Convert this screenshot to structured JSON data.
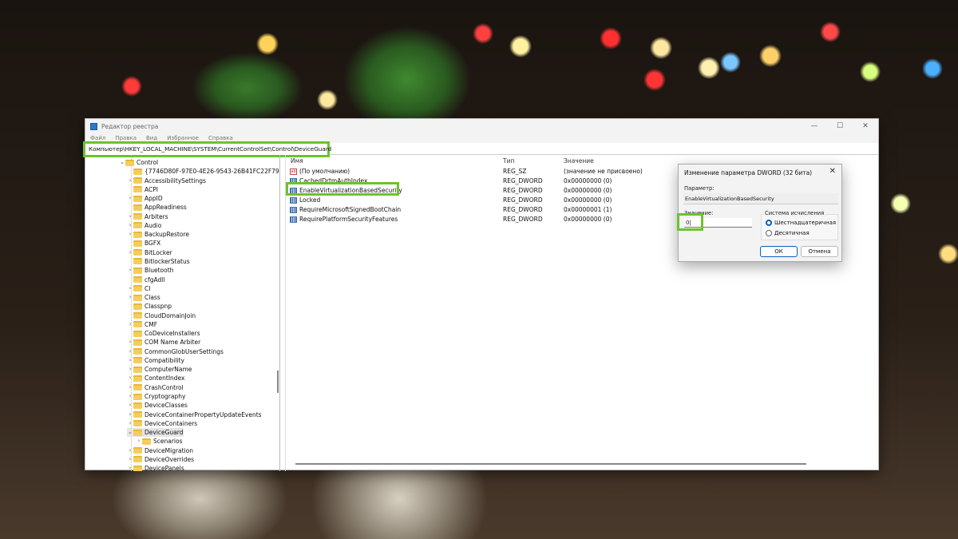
{
  "window": {
    "title": "Редактор реестра",
    "controls": [
      "—",
      "☐",
      "✕"
    ]
  },
  "menu": [
    "Файл",
    "Правка",
    "Вид",
    "Избранное",
    "Справка"
  ],
  "address": "Компьютер\\HKEY_LOCAL_MACHINE\\SYSTEM\\CurrentControlSet\\Control\\DeviceGuard",
  "tree": {
    "root": "Control",
    "items": [
      {
        "label": "{7746D80F-97E0-4E26-9543-26B41FC22F79}",
        "exp": false
      },
      {
        "label": "AccessibilitySettings",
        "exp": true
      },
      {
        "label": "ACPI",
        "exp": false
      },
      {
        "label": "AppID",
        "exp": true
      },
      {
        "label": "AppReadiness",
        "exp": false
      },
      {
        "label": "Arbiters",
        "exp": true
      },
      {
        "label": "Audio",
        "exp": true
      },
      {
        "label": "BackupRestore",
        "exp": true
      },
      {
        "label": "BGFX",
        "exp": false
      },
      {
        "label": "BitLocker",
        "exp": true
      },
      {
        "label": "BitlockerStatus",
        "exp": false
      },
      {
        "label": "Bluetooth",
        "exp": true
      },
      {
        "label": "cfgAdll",
        "exp": false
      },
      {
        "label": "CI",
        "exp": true
      },
      {
        "label": "Class",
        "exp": true
      },
      {
        "label": "Classpnp",
        "exp": false
      },
      {
        "label": "CloudDomainJoin",
        "exp": false
      },
      {
        "label": "CMF",
        "exp": true
      },
      {
        "label": "CoDeviceInstallers",
        "exp": false
      },
      {
        "label": "COM Name Arbiter",
        "exp": true
      },
      {
        "label": "CommonGlobUserSettings",
        "exp": true
      },
      {
        "label": "Compatibility",
        "exp": true
      },
      {
        "label": "ComputerName",
        "exp": true
      },
      {
        "label": "ContentIndex",
        "exp": true
      },
      {
        "label": "CrashControl",
        "exp": true
      },
      {
        "label": "Cryptography",
        "exp": true
      },
      {
        "label": "DeviceClasses",
        "exp": true
      },
      {
        "label": "DeviceContainerPropertyUpdateEvents",
        "exp": true
      },
      {
        "label": "DeviceContainers",
        "exp": true
      },
      {
        "label": "DeviceGuard",
        "exp": true,
        "open": true,
        "selected": true
      },
      {
        "label": "Scenarios",
        "exp": true,
        "child": true
      },
      {
        "label": "DeviceMigration",
        "exp": true
      },
      {
        "label": "DeviceOverrides",
        "exp": true
      },
      {
        "label": "DevicePanels",
        "exp": true
      }
    ]
  },
  "list": {
    "headers": [
      "Имя",
      "Тип",
      "Значение"
    ],
    "rows": [
      {
        "name": "(По умолчанию)",
        "type": "REG_SZ",
        "value": "(значение не присвоено)",
        "icon": "string"
      },
      {
        "name": "CachedDrtmAuthIndex",
        "type": "REG_DWORD",
        "value": "0x00000000 (0)",
        "icon": "dword"
      },
      {
        "name": "EnableVirtualizationBasedSecurity",
        "type": "REG_DWORD",
        "value": "0x00000000 (0)",
        "icon": "dword"
      },
      {
        "name": "Locked",
        "type": "REG_DWORD",
        "value": "0x00000000 (0)",
        "icon": "dword"
      },
      {
        "name": "RequireMicrosoftSignedBootChain",
        "type": "REG_DWORD",
        "value": "0x00000001 (1)",
        "icon": "dword"
      },
      {
        "name": "RequirePlatformSecurityFeatures",
        "type": "REG_DWORD",
        "value": "0x00000000 (0)",
        "icon": "dword"
      }
    ]
  },
  "dialog": {
    "title": "Изменение параметра DWORD (32 бита)",
    "close": "✕",
    "param_label": "Параметр:",
    "param_value": "EnableVirtualizationBasedSecurity",
    "value_label": "Значение:",
    "value": "0",
    "base_label": "Система исчисления",
    "hex": "Шестнадцатеричная",
    "dec": "Десятичная",
    "ok": "ОК",
    "cancel": "Отмена"
  },
  "colors": {
    "highlight": "#6cc32c",
    "accent": "#0a5ec0"
  }
}
